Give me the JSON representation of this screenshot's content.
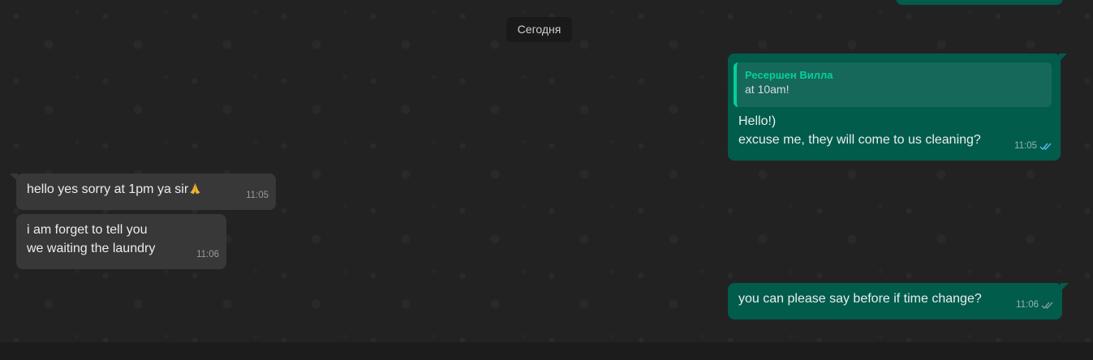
{
  "date_chip": "Сегодня",
  "messages": [
    {
      "direction": "out",
      "partial": true
    },
    {
      "direction": "out",
      "quote": {
        "author": "Ресершен Вилла",
        "text": "at 10am!"
      },
      "lines": [
        "Hello!)",
        "excuse me, they will come to us cleaning?"
      ],
      "time": "11:05",
      "status": "read",
      "status_icon": "double-check-icon",
      "status_color": "#53bdeb"
    },
    {
      "direction": "in",
      "lines": [
        "hello yes sorry at 1pm ya sir"
      ],
      "emoji": "folded-hands-icon",
      "time": "11:05"
    },
    {
      "direction": "in",
      "lines": [
        "i am forget to tell you",
        "we waiting the laundry"
      ],
      "time": "11:06"
    },
    {
      "direction": "out",
      "lines": [
        "you can please say before if time change?"
      ],
      "time": "11:06",
      "status": "delivered",
      "status_icon": "double-check-icon",
      "status_color": "#8696a0"
    }
  ],
  "colors": {
    "outgoing_bubble": "#025c4c",
    "incoming_bubble": "#383838",
    "quote_accent": "#06cf9c",
    "chat_background": "#222222"
  }
}
